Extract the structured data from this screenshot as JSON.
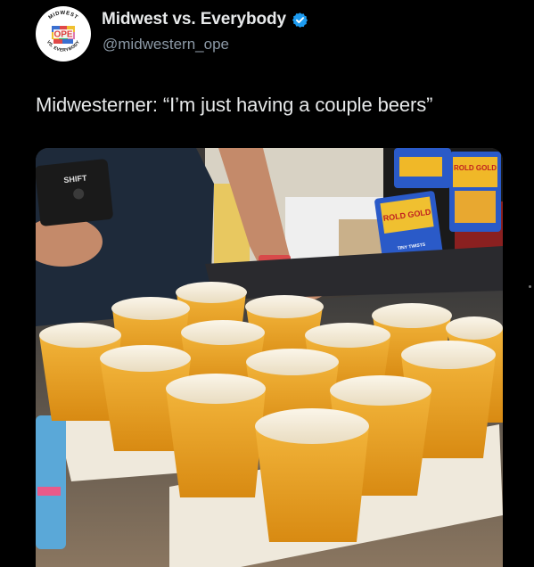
{
  "post": {
    "author": {
      "display_name": "Midwest vs. Everybody",
      "handle": "@midwestern_ope",
      "verified": true,
      "verified_icon": "verified-badge-icon",
      "avatar": {
        "logo_main": "OPE",
        "logo_top": "MIDWEST",
        "logo_bottom": "VS. EVERYBODY"
      }
    },
    "text": "Midwesterner: “I’m just having a couple beers”",
    "media": {
      "shift_box_label": "SHIFT",
      "snack_brand": "ROLD GOLD",
      "snack_subtext": "TINY TWISTS"
    }
  },
  "colors": {
    "background": "#000000",
    "name_text": "#e7e9ea",
    "handle_text": "#8b98a5",
    "verified_blue": "#1d9bf0",
    "beer": "#e8a020",
    "foam": "#f6efe0"
  }
}
